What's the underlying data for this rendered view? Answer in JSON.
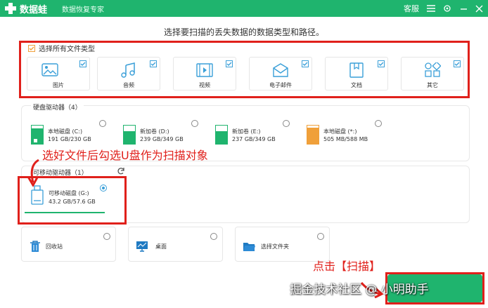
{
  "app": {
    "name": "数据蛙",
    "subtitle": "数据恢复专家",
    "service_label": "客服",
    "brand_color": "#1fb46e"
  },
  "heading": "选择要扫描的丢失数据的数据类型和路径。",
  "file_types": {
    "select_all_label": "选择所有文件类型",
    "items": [
      {
        "label": "图片",
        "icon": "image-icon",
        "checked": true
      },
      {
        "label": "音频",
        "icon": "music-icon",
        "checked": true
      },
      {
        "label": "视频",
        "icon": "video-icon",
        "checked": true
      },
      {
        "label": "电子邮件",
        "icon": "mail-icon",
        "checked": true
      },
      {
        "label": "文档",
        "icon": "document-icon",
        "checked": true
      },
      {
        "label": "其它",
        "icon": "other-icon",
        "checked": true
      }
    ]
  },
  "hard_drives": {
    "title": "硬盘驱动器（4）",
    "items": [
      {
        "name": "本地磁盘 (C:)",
        "size": "191 GB/230 GB",
        "fill": 0.83,
        "color": "#1fb46e"
      },
      {
        "name": "新加卷 (D:)",
        "size": "239 GB/349 GB",
        "fill": 0.68,
        "color": "#1fb46e"
      },
      {
        "name": "新加卷 (E:)",
        "size": "237 GB/349 GB",
        "fill": 0.68,
        "color": "#1fb46e"
      },
      {
        "name": "本地磁盘 (*:)",
        "size": "505 MB/588 MB",
        "fill": 0.86,
        "color": "#f0a03a"
      }
    ]
  },
  "removable": {
    "title_visible": "可移动驱动器（1）",
    "item": {
      "name": "可移动磁盘 (G:)",
      "size": "43.2 GB/57.6 GB",
      "selected": true
    }
  },
  "locations": [
    {
      "label": "回收站",
      "icon": "recycle-bin-icon"
    },
    {
      "label": "桌面",
      "icon": "desktop-icon"
    },
    {
      "label": "选择文件夹",
      "icon": "folder-icon"
    }
  ],
  "annotations": {
    "instruction": "选好文件后勾选U盘作为扫描对象",
    "click_scan": "点击【扫描】",
    "watermark": "掘金技术社区 @ 小明助手"
  },
  "colors": {
    "highlight_red": "#e0201b",
    "check_blue": "#3a9fd8",
    "select_all_orange": "#f0a03a"
  }
}
